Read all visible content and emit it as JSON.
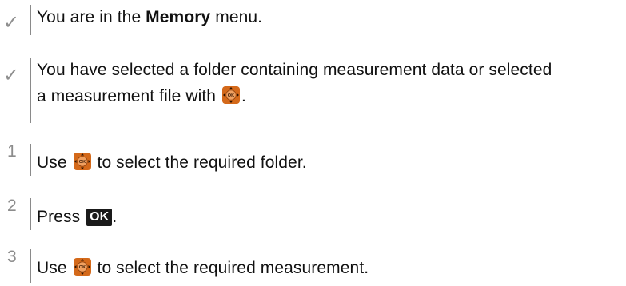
{
  "steps": [
    {
      "marker_icon": "check-icon",
      "marker_symbol": "✓",
      "text_before": "You are in the ",
      "text_bold": "Memory",
      "text_after": " menu."
    },
    {
      "marker_icon": "check-icon",
      "marker_symbol": "✓",
      "line1": "You have selected a folder containing measurement data or selected",
      "line2_before": "a measurement file with ",
      "line2_after": "."
    },
    {
      "number": "1",
      "text_before": "Use ",
      "text_after": " to select the required folder."
    },
    {
      "number": "2",
      "text_before": "Press ",
      "key_label": "OK",
      "text_after": "."
    },
    {
      "number": "3",
      "text_before": "Use ",
      "text_after": " to select the required measurement."
    }
  ],
  "icons": {
    "joystick_button": "ok-joystick-button-icon",
    "joystick_label": "OK",
    "joystick_color": "#d4691a",
    "key_color": "#1a1a1a"
  }
}
